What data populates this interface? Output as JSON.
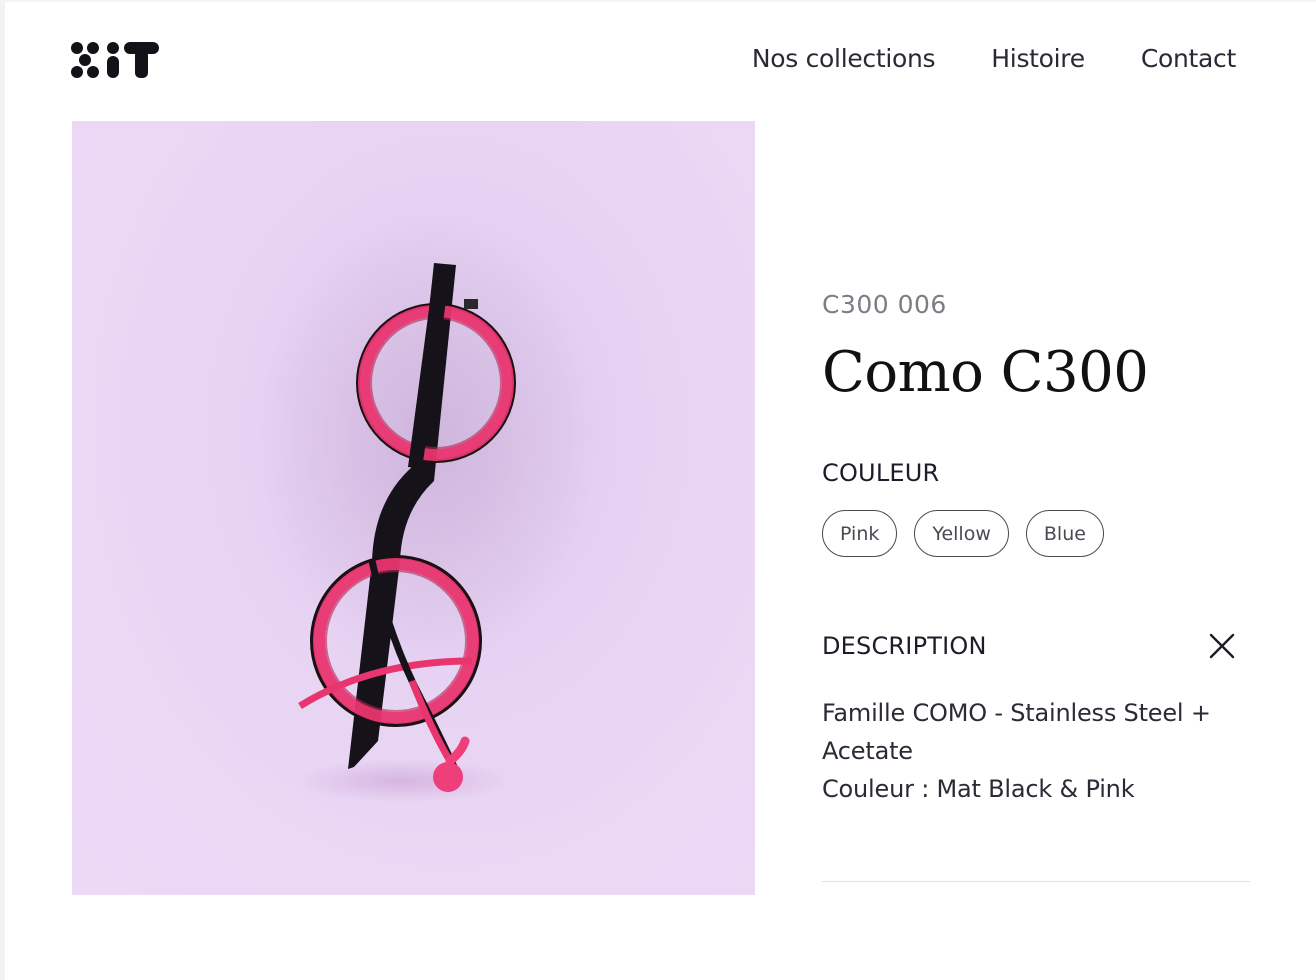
{
  "brand": {
    "logo_icon": "kit-logo"
  },
  "nav": {
    "items": [
      {
        "label": "Nos collections"
      },
      {
        "label": "Histoire"
      },
      {
        "label": "Contact"
      }
    ]
  },
  "product": {
    "sku": "C300 006",
    "name": "Como C300",
    "image_icon": "glasses-product-photo",
    "colors_label": "COULEUR",
    "colors": [
      {
        "label": "Pink"
      },
      {
        "label": "Yellow"
      },
      {
        "label": "Blue"
      }
    ],
    "description_label": "DESCRIPTION",
    "description_lines": [
      "Famille COMO - Stainless Steel + Acetate",
      "Couleur : Mat Black & Pink"
    ]
  },
  "colors": {
    "background": "#ffffff",
    "image_bg": "#ebd8f5",
    "frame_pink": "#e8356f",
    "text": "#1b1b26"
  }
}
